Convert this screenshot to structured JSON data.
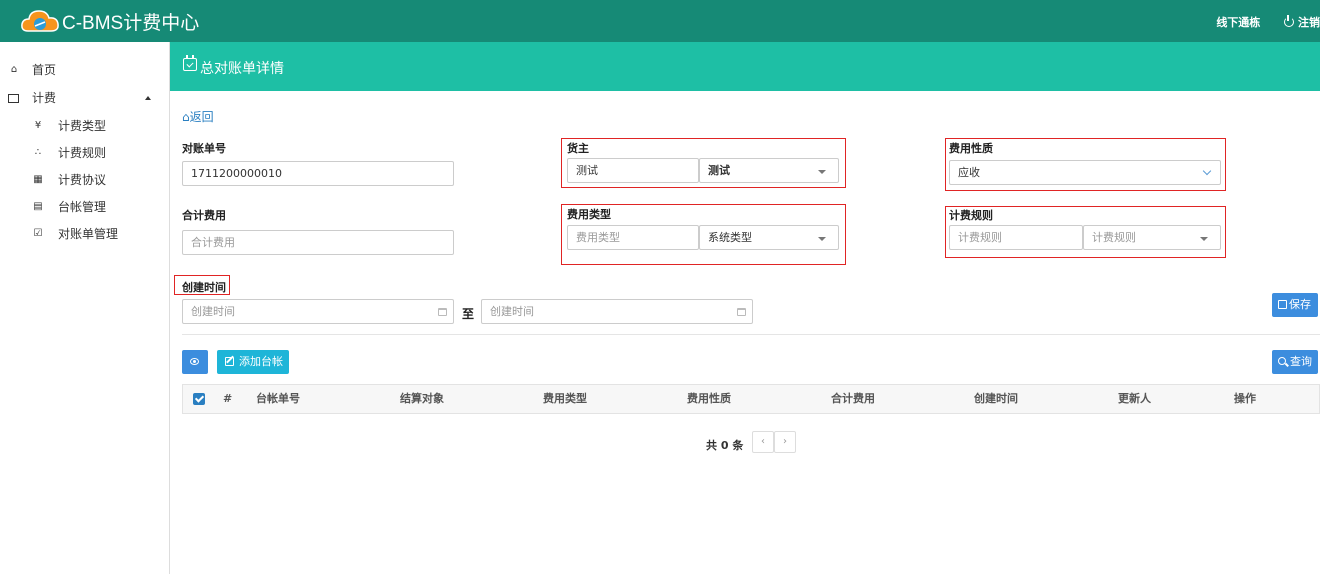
{
  "app": {
    "title": "C-BMS计费中心"
  },
  "topbar": {
    "link1": "线下通栋",
    "logout": "注销"
  },
  "sidebar": {
    "items": [
      {
        "label": "首页",
        "icon": "home-icon"
      },
      {
        "label": "计费",
        "icon": "picture-icon",
        "expanded": true
      },
      {
        "label": "计费类型",
        "icon": "yen-icon"
      },
      {
        "label": "计费规则",
        "icon": "sitemap-icon"
      },
      {
        "label": "计费协议",
        "icon": "calendar-icon"
      },
      {
        "label": "台帐管理",
        "icon": "book-icon"
      },
      {
        "label": "对账单管理",
        "icon": "calendar-check-icon"
      }
    ]
  },
  "page": {
    "title": "总对账单详情",
    "back": "返回"
  },
  "form": {
    "statement_no": {
      "label": "对账单号",
      "value": "1711200000010"
    },
    "total_fee": {
      "label": "合计费用",
      "placeholder": "合计费用"
    },
    "owner": {
      "label": "货主",
      "value1": "测试",
      "value2": "测试"
    },
    "fee_type": {
      "label": "费用类型",
      "placeholder": "费用类型",
      "select": "系统类型"
    },
    "fee_nature": {
      "label": "费用性质",
      "value": "应收"
    },
    "billing_rule": {
      "label": "计费规则",
      "placeholder1": "计费规则",
      "placeholder2": "计费规则"
    },
    "created_time": {
      "label": "创建时间",
      "from_placeholder": "创建时间",
      "to_label": "至",
      "to_placeholder": "创建时间"
    }
  },
  "buttons": {
    "save": "保存",
    "add_ledger": "添加台帐",
    "query": "查询"
  },
  "table": {
    "columns": [
      "#",
      "台帐单号",
      "结算对象",
      "费用类型",
      "费用性质",
      "合计费用",
      "创建时间",
      "更新人",
      "操作"
    ],
    "rows": []
  },
  "pager": {
    "summary": "共 0 条",
    "prev": "‹",
    "next": "›"
  },
  "colors": {
    "topbar": "#168a76",
    "pagebar": "#1ebfa5",
    "primary": "#3c8dde",
    "cyan": "#1eb5d8",
    "highlight": "#e02424"
  }
}
